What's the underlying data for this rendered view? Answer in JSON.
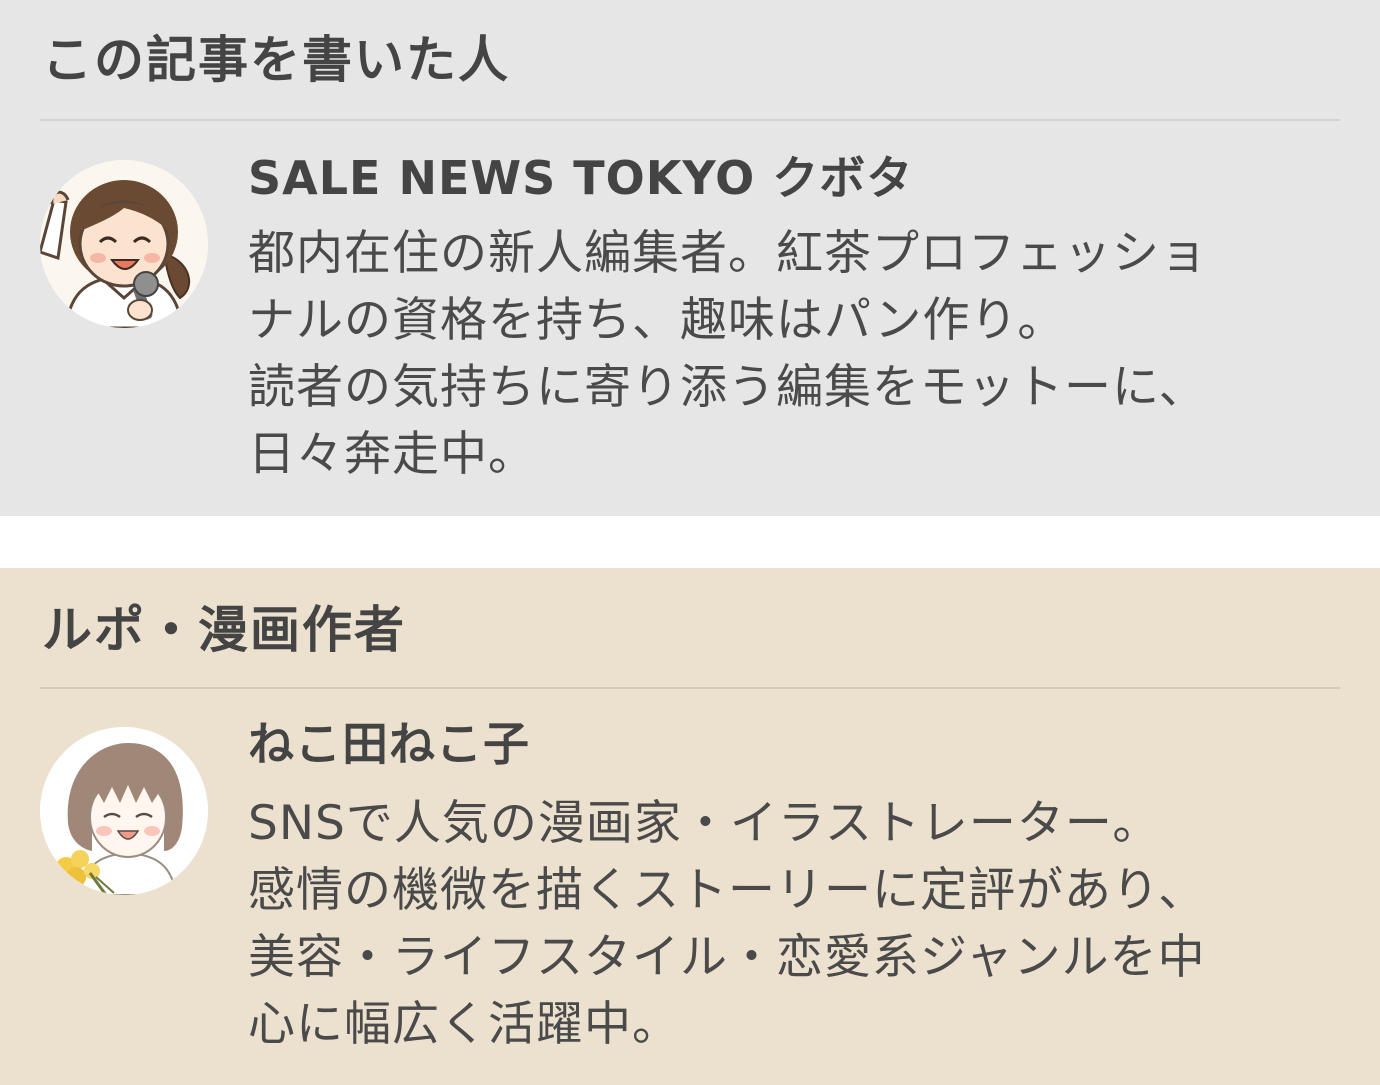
{
  "author_card": {
    "heading": "この記事を書いた人",
    "name": "SALE NEWS TOKYO クボタ",
    "bio_lines": [
      "都内在住の新人編集者。紅茶プロフェッショ",
      "ナルの資格を持ち、趣味はパン作り。",
      "読者の気持ちに寄り添う編集をモットーに、",
      "日々奔走中。"
    ]
  },
  "illustrator_card": {
    "heading": "ルポ・漫画作者",
    "name": "ねこ田ねこ子",
    "bio_lines": [
      "SNSで人気の漫画家・イラストレーター。",
      "感情の機微を描くストーリーに定評があり、",
      "美容・ライフスタイル・恋愛系ジャンルを中",
      "心に幅広く活躍中。"
    ]
  },
  "colors": {
    "author_card_bg": "#e6e6e6",
    "illustrator_card_bg": "#ece1cf",
    "text": "#454545"
  }
}
